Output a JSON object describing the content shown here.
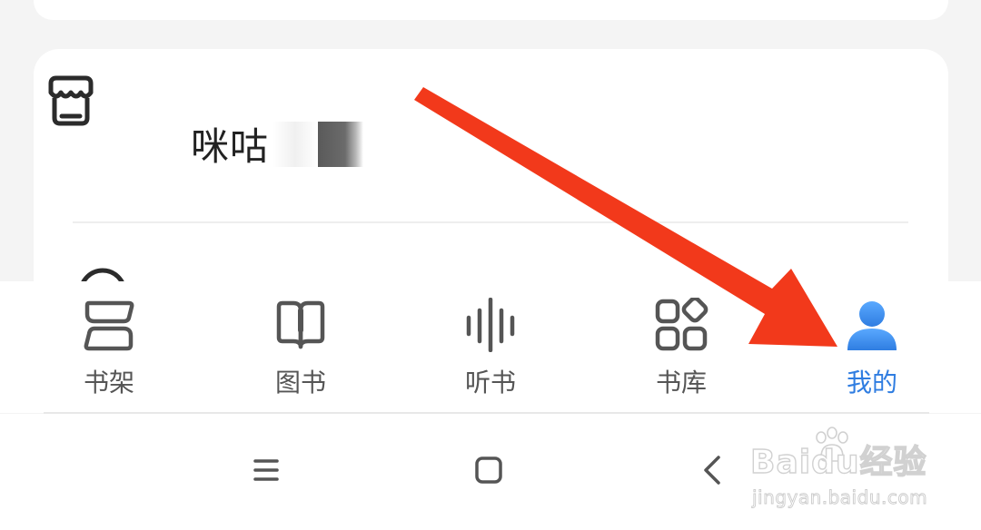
{
  "menu": {
    "items": [
      {
        "label": "咪咕",
        "icon": "store-icon"
      }
    ]
  },
  "tabbar": {
    "tabs": [
      {
        "label": "书架",
        "icon": "bookshelf-icon",
        "active": false
      },
      {
        "label": "图书",
        "icon": "book-icon",
        "active": false
      },
      {
        "label": "听书",
        "icon": "audio-wave-icon",
        "active": false
      },
      {
        "label": "书库",
        "icon": "library-grid-icon",
        "active": false
      },
      {
        "label": "我的",
        "icon": "user-profile-icon",
        "active": true
      }
    ],
    "active_color": "#2f7de1",
    "inactive_color": "#555555"
  },
  "system_nav": {
    "buttons": [
      {
        "icon": "menu-icon"
      },
      {
        "icon": "home-square-icon"
      },
      {
        "icon": "back-chevron-icon"
      }
    ]
  },
  "watermark": {
    "brand": "Baidu经验",
    "url": "jingyan.baidu.com"
  },
  "annotation": {
    "arrow_color": "#f2391b"
  }
}
